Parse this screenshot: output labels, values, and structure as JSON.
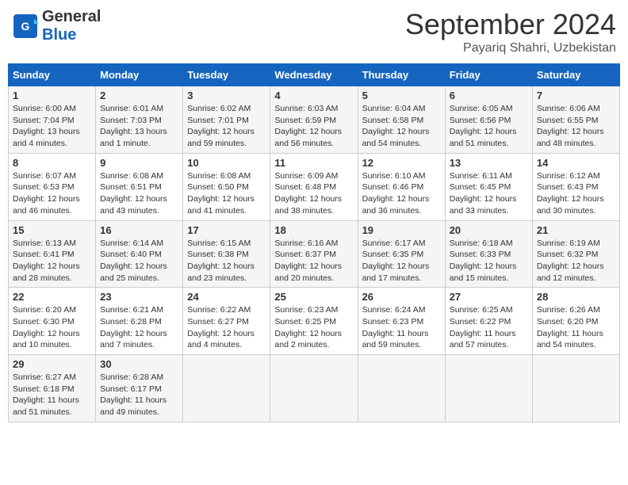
{
  "header": {
    "logo_general": "General",
    "logo_blue": "Blue",
    "month_year": "September 2024",
    "location": "Payariq Shahri, Uzbekistan"
  },
  "columns": [
    "Sunday",
    "Monday",
    "Tuesday",
    "Wednesday",
    "Thursday",
    "Friday",
    "Saturday"
  ],
  "weeks": [
    [
      {
        "day": "1",
        "sunrise": "Sunrise: 6:00 AM",
        "sunset": "Sunset: 7:04 PM",
        "daylight": "Daylight: 13 hours and 4 minutes."
      },
      {
        "day": "2",
        "sunrise": "Sunrise: 6:01 AM",
        "sunset": "Sunset: 7:03 PM",
        "daylight": "Daylight: 13 hours and 1 minute."
      },
      {
        "day": "3",
        "sunrise": "Sunrise: 6:02 AM",
        "sunset": "Sunset: 7:01 PM",
        "daylight": "Daylight: 12 hours and 59 minutes."
      },
      {
        "day": "4",
        "sunrise": "Sunrise: 6:03 AM",
        "sunset": "Sunset: 6:59 PM",
        "daylight": "Daylight: 12 hours and 56 minutes."
      },
      {
        "day": "5",
        "sunrise": "Sunrise: 6:04 AM",
        "sunset": "Sunset: 6:58 PM",
        "daylight": "Daylight: 12 hours and 54 minutes."
      },
      {
        "day": "6",
        "sunrise": "Sunrise: 6:05 AM",
        "sunset": "Sunset: 6:56 PM",
        "daylight": "Daylight: 12 hours and 51 minutes."
      },
      {
        "day": "7",
        "sunrise": "Sunrise: 6:06 AM",
        "sunset": "Sunset: 6:55 PM",
        "daylight": "Daylight: 12 hours and 48 minutes."
      }
    ],
    [
      {
        "day": "8",
        "sunrise": "Sunrise: 6:07 AM",
        "sunset": "Sunset: 6:53 PM",
        "daylight": "Daylight: 12 hours and 46 minutes."
      },
      {
        "day": "9",
        "sunrise": "Sunrise: 6:08 AM",
        "sunset": "Sunset: 6:51 PM",
        "daylight": "Daylight: 12 hours and 43 minutes."
      },
      {
        "day": "10",
        "sunrise": "Sunrise: 6:08 AM",
        "sunset": "Sunset: 6:50 PM",
        "daylight": "Daylight: 12 hours and 41 minutes."
      },
      {
        "day": "11",
        "sunrise": "Sunrise: 6:09 AM",
        "sunset": "Sunset: 6:48 PM",
        "daylight": "Daylight: 12 hours and 38 minutes."
      },
      {
        "day": "12",
        "sunrise": "Sunrise: 6:10 AM",
        "sunset": "Sunset: 6:46 PM",
        "daylight": "Daylight: 12 hours and 36 minutes."
      },
      {
        "day": "13",
        "sunrise": "Sunrise: 6:11 AM",
        "sunset": "Sunset: 6:45 PM",
        "daylight": "Daylight: 12 hours and 33 minutes."
      },
      {
        "day": "14",
        "sunrise": "Sunrise: 6:12 AM",
        "sunset": "Sunset: 6:43 PM",
        "daylight": "Daylight: 12 hours and 30 minutes."
      }
    ],
    [
      {
        "day": "15",
        "sunrise": "Sunrise: 6:13 AM",
        "sunset": "Sunset: 6:41 PM",
        "daylight": "Daylight: 12 hours and 28 minutes."
      },
      {
        "day": "16",
        "sunrise": "Sunrise: 6:14 AM",
        "sunset": "Sunset: 6:40 PM",
        "daylight": "Daylight: 12 hours and 25 minutes."
      },
      {
        "day": "17",
        "sunrise": "Sunrise: 6:15 AM",
        "sunset": "Sunset: 6:38 PM",
        "daylight": "Daylight: 12 hours and 23 minutes."
      },
      {
        "day": "18",
        "sunrise": "Sunrise: 6:16 AM",
        "sunset": "Sunset: 6:37 PM",
        "daylight": "Daylight: 12 hours and 20 minutes."
      },
      {
        "day": "19",
        "sunrise": "Sunrise: 6:17 AM",
        "sunset": "Sunset: 6:35 PM",
        "daylight": "Daylight: 12 hours and 17 minutes."
      },
      {
        "day": "20",
        "sunrise": "Sunrise: 6:18 AM",
        "sunset": "Sunset: 6:33 PM",
        "daylight": "Daylight: 12 hours and 15 minutes."
      },
      {
        "day": "21",
        "sunrise": "Sunrise: 6:19 AM",
        "sunset": "Sunset: 6:32 PM",
        "daylight": "Daylight: 12 hours and 12 minutes."
      }
    ],
    [
      {
        "day": "22",
        "sunrise": "Sunrise: 6:20 AM",
        "sunset": "Sunset: 6:30 PM",
        "daylight": "Daylight: 12 hours and 10 minutes."
      },
      {
        "day": "23",
        "sunrise": "Sunrise: 6:21 AM",
        "sunset": "Sunset: 6:28 PM",
        "daylight": "Daylight: 12 hours and 7 minutes."
      },
      {
        "day": "24",
        "sunrise": "Sunrise: 6:22 AM",
        "sunset": "Sunset: 6:27 PM",
        "daylight": "Daylight: 12 hours and 4 minutes."
      },
      {
        "day": "25",
        "sunrise": "Sunrise: 6:23 AM",
        "sunset": "Sunset: 6:25 PM",
        "daylight": "Daylight: 12 hours and 2 minutes."
      },
      {
        "day": "26",
        "sunrise": "Sunrise: 6:24 AM",
        "sunset": "Sunset: 6:23 PM",
        "daylight": "Daylight: 11 hours and 59 minutes."
      },
      {
        "day": "27",
        "sunrise": "Sunrise: 6:25 AM",
        "sunset": "Sunset: 6:22 PM",
        "daylight": "Daylight: 11 hours and 57 minutes."
      },
      {
        "day": "28",
        "sunrise": "Sunrise: 6:26 AM",
        "sunset": "Sunset: 6:20 PM",
        "daylight": "Daylight: 11 hours and 54 minutes."
      }
    ],
    [
      {
        "day": "29",
        "sunrise": "Sunrise: 6:27 AM",
        "sunset": "Sunset: 6:18 PM",
        "daylight": "Daylight: 11 hours and 51 minutes."
      },
      {
        "day": "30",
        "sunrise": "Sunrise: 6:28 AM",
        "sunset": "Sunset: 6:17 PM",
        "daylight": "Daylight: 11 hours and 49 minutes."
      },
      null,
      null,
      null,
      null,
      null
    ]
  ]
}
